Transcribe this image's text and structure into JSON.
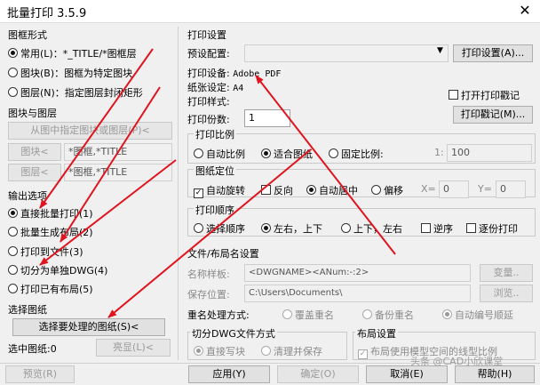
{
  "window": {
    "title": "批量打印 3.5.9",
    "close_glyph": "✕"
  },
  "frame_mode": {
    "heading": "图框形式",
    "options": [
      "常用(L)：*_TITLE/*图框层",
      "图块(B)：图框为特定图块",
      "图层(N)：指定图层封闭矩形"
    ],
    "selected": 0
  },
  "block_layer": {
    "heading": "图块与图层",
    "pick_button": "从图中指定图块或图层(P)<",
    "block_button": "图块<",
    "block_value": "*图框,*TITLE",
    "layer_button": "图层<",
    "layer_value": "*图框,*TITLE"
  },
  "output": {
    "heading": "输出选项",
    "options": [
      "直接批量打印(1)",
      "批量生成布局(2)",
      "打印到文件(3)",
      "切分为单独DWG(4)",
      "打印已有布局(5)"
    ],
    "selected": 0
  },
  "select_drawings": {
    "heading": "选择图纸",
    "select_button": "选择要处理的图纸(S)<",
    "selected_label": "选中图纸:0",
    "highlight_button": "亮显(L)<"
  },
  "print_settings": {
    "heading": "打印设置",
    "preset_label": "预设配置:",
    "preset_value": "",
    "setup_button": "打印设置(A)...",
    "device_label": "打印设备:",
    "device_value": "Adobe PDF",
    "paper_label": "纸张设定:",
    "paper_value": "A4",
    "style_label": "打印样式:",
    "style_value": "",
    "stamp_check": "打开打印戳记",
    "stamp_checked": false,
    "stamp_button": "打印戳记(M)...",
    "copies_label": "打印份数:",
    "copies_value": "1"
  },
  "scale": {
    "heading": "打印比例",
    "options": [
      "自动比例",
      "适合图纸",
      "固定比例:"
    ],
    "selected": 1,
    "prefix": "1:",
    "value": "100"
  },
  "position": {
    "heading": "图纸定位",
    "auto_rotate": "自动旋转",
    "auto_rotate_checked": true,
    "reverse": "反向",
    "reverse_checked": false,
    "options": [
      "自动居中",
      "偏移"
    ],
    "selected": 0,
    "x_label": "X=",
    "x_value": "0",
    "y_label": "Y=",
    "y_value": "0"
  },
  "order": {
    "heading": "打印顺序",
    "options": [
      "选择顺序",
      "左右，上下",
      "上下，左右"
    ],
    "selected": 1,
    "reverse": "逆序",
    "reverse_checked": false,
    "page_by_page": "逐份打印",
    "page_by_page_checked": false
  },
  "file_layout": {
    "heading": "文件/布局名设置",
    "name_label": "名称样板:",
    "name_value": "<DWGNAME><ANum:-:2>",
    "var_button": "变量..",
    "path_label": "保存位置:",
    "path_value": "C:\\Users\\Documents\\",
    "browse_button": "浏览..",
    "dup_label": "重名处理方式:",
    "dup_options": [
      "覆盖重名",
      "备份重名",
      "自动编号顺延"
    ],
    "dup_selected": 2
  },
  "split_mode": {
    "heading": "切分DWG文件方式",
    "options": [
      "直接写块",
      "清理并保存"
    ],
    "selected": 0
  },
  "layout_settings": {
    "heading": "布局设置",
    "linetype_check": "布局使用模型空间的线型比例",
    "linetype_checked": true
  },
  "footer": {
    "preview": "预览(R)",
    "apply": "应用(Y)",
    "ok": "确定(O)",
    "cancel": "取消(E)",
    "help": "帮助(H)"
  },
  "watermark": "头条 @CAD小欣课堂",
  "colors": {
    "arrow": "#e0141e"
  }
}
